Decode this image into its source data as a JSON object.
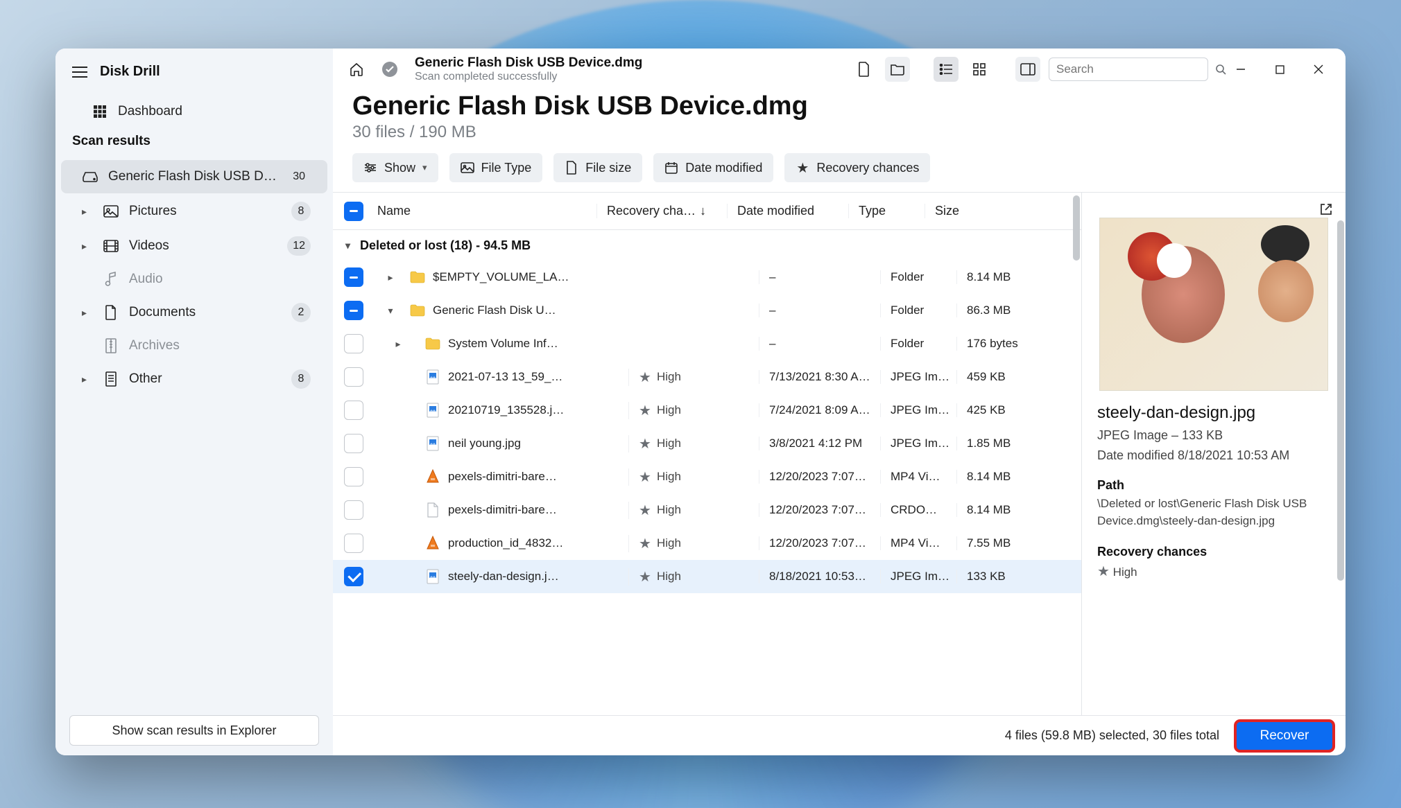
{
  "app": {
    "title": "Disk Drill"
  },
  "sidebar": {
    "dashboard": "Dashboard",
    "section_title": "Scan results",
    "bottom_button": "Show scan results in Explorer",
    "items": [
      {
        "label": "Generic Flash Disk USB D…",
        "count": "30",
        "icon": "drive",
        "selected": true,
        "expandable": false
      },
      {
        "label": "Pictures",
        "count": "8",
        "icon": "image",
        "expandable": true
      },
      {
        "label": "Videos",
        "count": "12",
        "icon": "film",
        "expandable": true
      },
      {
        "label": "Audio",
        "count": "",
        "icon": "music",
        "expandable": false,
        "muted": true
      },
      {
        "label": "Documents",
        "count": "2",
        "icon": "doc",
        "expandable": true
      },
      {
        "label": "Archives",
        "count": "",
        "icon": "archive",
        "expandable": false,
        "muted": true
      },
      {
        "label": "Other",
        "count": "8",
        "icon": "other",
        "expandable": true
      }
    ]
  },
  "topbar": {
    "title": "Generic Flash Disk USB Device.dmg",
    "subtitle": "Scan completed successfully",
    "search_placeholder": "Search"
  },
  "heading": {
    "title": "Generic Flash Disk USB Device.dmg",
    "subtitle": "30 files / 190 MB"
  },
  "filters": {
    "show": "Show",
    "file_type": "File Type",
    "file_size": "File size",
    "date_modified": "Date modified",
    "recovery": "Recovery chances"
  },
  "table": {
    "headers": {
      "name": "Name",
      "recovery": "Recovery cha…",
      "date": "Date modified",
      "type": "Type",
      "size": "Size"
    },
    "group_label": "Deleted or lost (18) - 94.5 MB",
    "rows": [
      {
        "chk": "minus",
        "indent": 0,
        "exp": "right",
        "icon": "folder",
        "name": "$EMPTY_VOLUME_LA…",
        "recovery": "",
        "date": "–",
        "type": "Folder",
        "size": "8.14 MB"
      },
      {
        "chk": "minus",
        "indent": 0,
        "exp": "down",
        "icon": "folder",
        "name": "Generic Flash Disk U…",
        "recovery": "",
        "date": "–",
        "type": "Folder",
        "size": "86.3 MB"
      },
      {
        "chk": "empty",
        "indent": 1,
        "exp": "right",
        "icon": "folder",
        "name": "System Volume Inf…",
        "recovery": "",
        "date": "–",
        "type": "Folder",
        "size": "176 bytes"
      },
      {
        "chk": "empty",
        "indent": 1,
        "exp": "",
        "icon": "image",
        "name": "2021-07-13 13_59_…",
        "recovery": "High",
        "date": "7/13/2021 8:30 A…",
        "type": "JPEG Im…",
        "size": "459 KB"
      },
      {
        "chk": "empty",
        "indent": 1,
        "exp": "",
        "icon": "image",
        "name": "20210719_135528.j…",
        "recovery": "High",
        "date": "7/24/2021 8:09 A…",
        "type": "JPEG Im…",
        "size": "425 KB"
      },
      {
        "chk": "empty",
        "indent": 1,
        "exp": "",
        "icon": "image",
        "name": "neil young.jpg",
        "recovery": "High",
        "date": "3/8/2021 4:12 PM",
        "type": "JPEG Im…",
        "size": "1.85 MB"
      },
      {
        "chk": "empty",
        "indent": 1,
        "exp": "",
        "icon": "video",
        "name": "pexels-dimitri-bare…",
        "recovery": "High",
        "date": "12/20/2023 7:07…",
        "type": "MP4 Vi…",
        "size": "8.14 MB"
      },
      {
        "chk": "empty",
        "indent": 1,
        "exp": "",
        "icon": "file",
        "name": "pexels-dimitri-bare…",
        "recovery": "High",
        "date": "12/20/2023 7:07…",
        "type": "CRDO…",
        "size": "8.14 MB"
      },
      {
        "chk": "empty",
        "indent": 1,
        "exp": "",
        "icon": "video",
        "name": "production_id_4832…",
        "recovery": "High",
        "date": "12/20/2023 7:07…",
        "type": "MP4 Vi…",
        "size": "7.55 MB"
      },
      {
        "chk": "check",
        "indent": 1,
        "exp": "",
        "icon": "image",
        "name": "steely-dan-design.j…",
        "recovery": "High",
        "date": "8/18/2021 10:53…",
        "type": "JPEG Im…",
        "size": "133 KB",
        "selected": true
      }
    ]
  },
  "preview": {
    "title": "steely-dan-design.jpg",
    "meta": "JPEG Image – 133 KB",
    "modified": "Date modified 8/18/2021 10:53 AM",
    "path_label": "Path",
    "path_value": "\\Deleted or lost\\Generic Flash Disk USB Device.dmg\\steely-dan-design.jpg",
    "recovery_label": "Recovery chances",
    "recovery_value": "High"
  },
  "footer": {
    "status": "4 files (59.8 MB) selected, 30 files total",
    "recover": "Recover"
  }
}
